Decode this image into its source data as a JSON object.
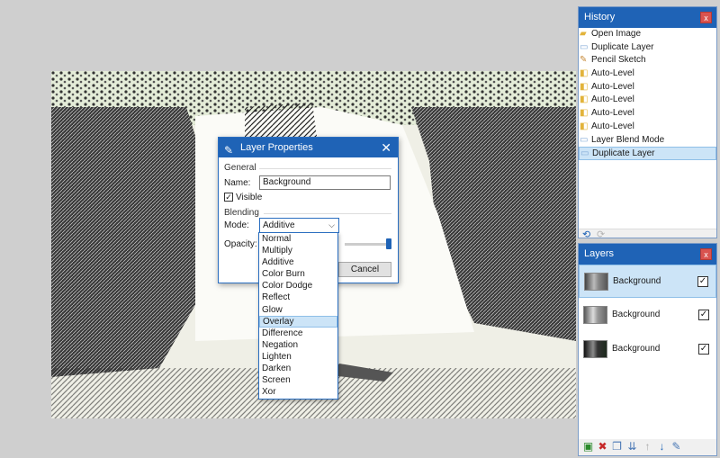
{
  "history": {
    "title": "History",
    "close": "x",
    "items": [
      {
        "label": "Open Image",
        "icon": "folder-icon"
      },
      {
        "label": "Duplicate Layer",
        "icon": "layer-icon"
      },
      {
        "label": "Pencil Sketch",
        "icon": "pencil-icon"
      },
      {
        "label": "Auto-Level",
        "icon": "adjustment-icon"
      },
      {
        "label": "Auto-Level",
        "icon": "adjustment-icon"
      },
      {
        "label": "Auto-Level",
        "icon": "adjustment-icon"
      },
      {
        "label": "Auto-Level",
        "icon": "adjustment-icon"
      },
      {
        "label": "Auto-Level",
        "icon": "adjustment-icon"
      },
      {
        "label": "Layer Blend Mode",
        "icon": "layer-icon"
      },
      {
        "label": "Duplicate Layer",
        "icon": "layer-icon"
      }
    ],
    "selected_index": 9
  },
  "layers": {
    "title": "Layers",
    "close": "x",
    "items": [
      {
        "name": "Background",
        "visible": true,
        "selected": true
      },
      {
        "name": "Background",
        "visible": true,
        "selected": false
      },
      {
        "name": "Background",
        "visible": true,
        "selected": false
      }
    ]
  },
  "dialog": {
    "title": "Layer Properties",
    "close": "✕",
    "general_heading": "General",
    "name_label": "Name:",
    "name_value": "Background",
    "visible_label": "Visible",
    "visible_checked": true,
    "blending_heading": "Blending",
    "mode_label": "Mode:",
    "mode_value": "Additive",
    "opacity_label": "Opacity:",
    "opacity_value_fraction": 1.0,
    "cancel_label": "Cancel"
  },
  "mode_options": [
    "Normal",
    "Multiply",
    "Additive",
    "Color Burn",
    "Color Dodge",
    "Reflect",
    "Glow",
    "Overlay",
    "Difference",
    "Negation",
    "Lighten",
    "Darken",
    "Screen",
    "Xor"
  ],
  "mode_hover_index": 7,
  "colors": {
    "title_bar": "#1f63b6",
    "close_button": "#d9534f",
    "selection": "#cce4f7",
    "workspace": "#cfcfcf"
  }
}
